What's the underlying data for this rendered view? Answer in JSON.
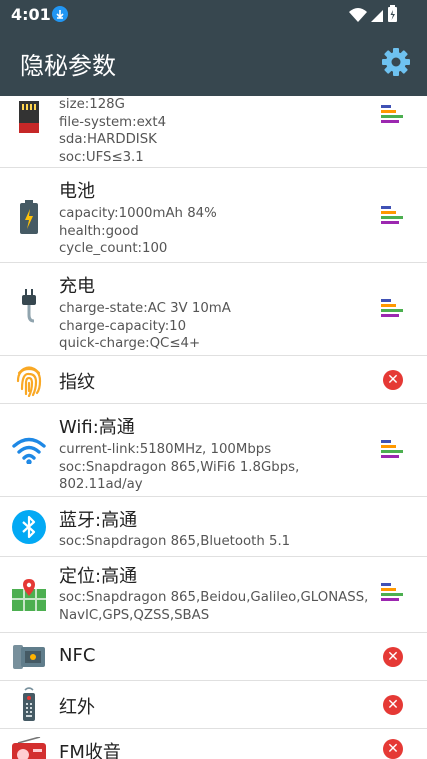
{
  "status": {
    "time": "4:01"
  },
  "appbar": {
    "title": "隐秘参数"
  },
  "colors": {
    "appbar": "#37474f",
    "accent": "#2196f3",
    "unsupported": "#e53935"
  },
  "items": [
    {
      "title": "",
      "lines": [
        "size:128G",
        "file-system:ext4",
        "sda:HARDDISK",
        "soc:UFS≤3.1"
      ],
      "icon": "sd-card-icon",
      "action": "bars"
    },
    {
      "title": "电池",
      "lines": [
        "capacity:1000mAh 84%",
        "health:good",
        "cycle_count:100"
      ],
      "icon": "battery-icon",
      "action": "bars"
    },
    {
      "title": "充电",
      "lines": [
        "charge-state:AC 3V 10mA",
        "charge-capacity:10",
        "quick-charge:QC≤4+"
      ],
      "icon": "charger-plug-icon",
      "action": "bars"
    },
    {
      "title": "指纹",
      "lines": [],
      "icon": "fingerprint-icon",
      "action": "x"
    },
    {
      "title": "Wifi:高通",
      "lines": [
        "current-link:5180MHz, 100Mbps",
        "soc:Snapdragon 865,WiFi6 1.8Gbps, 802.11ad/ay"
      ],
      "icon": "wifi-icon",
      "action": "bars"
    },
    {
      "title": "蓝牙:高通",
      "lines": [
        "soc:Snapdragon 865,Bluetooth 5.1"
      ],
      "icon": "bluetooth-icon",
      "action": "none"
    },
    {
      "title": "定位:高通",
      "lines": [
        "soc:Snapdragon 865,Beidou,Galileo,GLONASS,",
        "NavIC,GPS,QZSS,SBAS"
      ],
      "icon": "map-pin-icon",
      "action": "bars"
    },
    {
      "title": "NFC",
      "lines": [],
      "icon": "nfc-icon",
      "action": "x"
    },
    {
      "title": "红外",
      "lines": [],
      "icon": "remote-control-icon",
      "action": "x"
    },
    {
      "title": "FM收音",
      "lines": [],
      "icon": "radio-icon",
      "action": "x"
    }
  ]
}
